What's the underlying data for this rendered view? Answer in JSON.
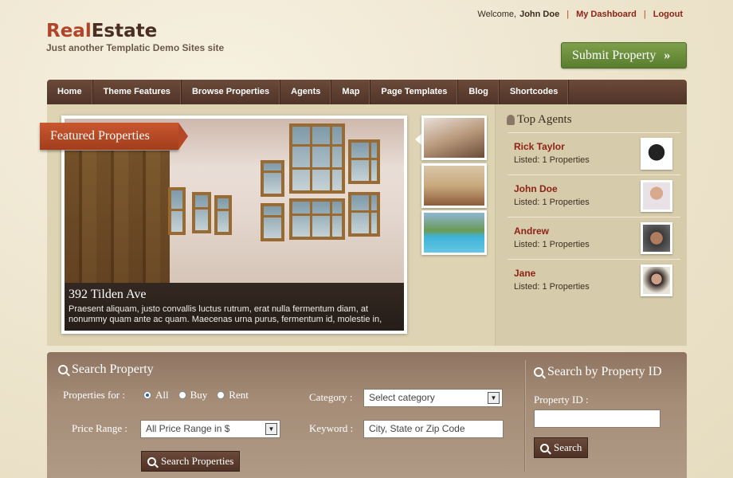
{
  "header": {
    "logo_part1": "Real",
    "logo_part2": "Estate",
    "tagline": "Just another Templatic Demo Sites site",
    "welcome": "Welcome,",
    "user": "John Doe",
    "sep1": "|",
    "dashboard": "My Dashboard",
    "sep2": "|",
    "logout": "Logout",
    "submit_label": "Submit Property",
    "submit_arrow": "»"
  },
  "nav": {
    "items": [
      "Home",
      "Theme Features",
      "Browse Properties",
      "Agents",
      "Map",
      "Page Templates",
      "Blog",
      "Shortcodes"
    ]
  },
  "featured": {
    "ribbon": "Featured Properties",
    "title": "392 Tilden Ave",
    "text": "Praesent aliquam, justo convallis luctus rutrum, erat nulla fermentum diam, at nonummy quam ante ac quam. Maecenas urna purus, fermentum id, molestie in,"
  },
  "agents": {
    "title": "Top Agents",
    "list": [
      {
        "name": "Rick Taylor",
        "listed": "Listed: 1 Properties"
      },
      {
        "name": "John Doe",
        "listed": "Listed: 1 Properties"
      },
      {
        "name": "Andrew",
        "listed": "Listed: 1 Properties"
      },
      {
        "name": "Jane",
        "listed": "Listed: 1 Properties"
      }
    ]
  },
  "search": {
    "title": "Search Property",
    "properties_for_label": "Properties for :",
    "options": [
      "All",
      "Buy",
      "Rent"
    ],
    "selected_option": "All",
    "category_label": "Category :",
    "category_value": "Select category",
    "price_label": "Price Range :",
    "price_value": "All Price Range in $",
    "keyword_label": "Keyword :",
    "keyword_placeholder": "City, State or Zip Code",
    "button": "Search Properties"
  },
  "search_id": {
    "title": "Search by Property ID",
    "label": "Property ID :",
    "value": "",
    "button": "Search"
  },
  "colors": {
    "brand_red": "#b2442a",
    "nav_brown": "#5a3d2f",
    "submit_green": "#6b8f3d",
    "link_red": "#8f2216"
  }
}
